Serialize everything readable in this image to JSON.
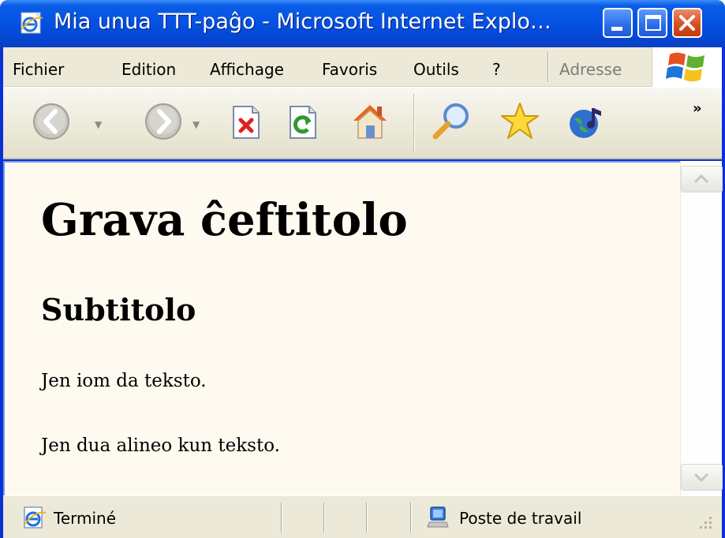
{
  "window": {
    "title": "Mia unua TTT-paĝo - Microsoft Internet Explo…"
  },
  "menu": {
    "items": [
      {
        "label": "Fichier"
      },
      {
        "label": "Edition"
      },
      {
        "label": "Affichage"
      },
      {
        "label": "Favoris"
      },
      {
        "label": "Outils"
      },
      {
        "label": "?"
      }
    ],
    "address_label": "Adresse"
  },
  "toolbar": {
    "icons": [
      "back-arrow-icon",
      "forward-arrow-icon",
      "stop-icon",
      "refresh-icon",
      "home-icon",
      "search-icon",
      "favorites-star-icon",
      "media-icon"
    ],
    "overflow": "»"
  },
  "content": {
    "heading": "Grava ĉeftitolo",
    "subheading": "Subtitolo",
    "paragraphs": [
      "Jen iom da teksto.",
      "Jen dua alineo kun teksto."
    ],
    "background": "#fffaf0"
  },
  "status": {
    "text": "Terminé",
    "zone": "Poste de travail"
  },
  "colors": {
    "titlebar": "#0553e3",
    "chrome": "#ece9d8",
    "close_button": "#d5501f"
  }
}
